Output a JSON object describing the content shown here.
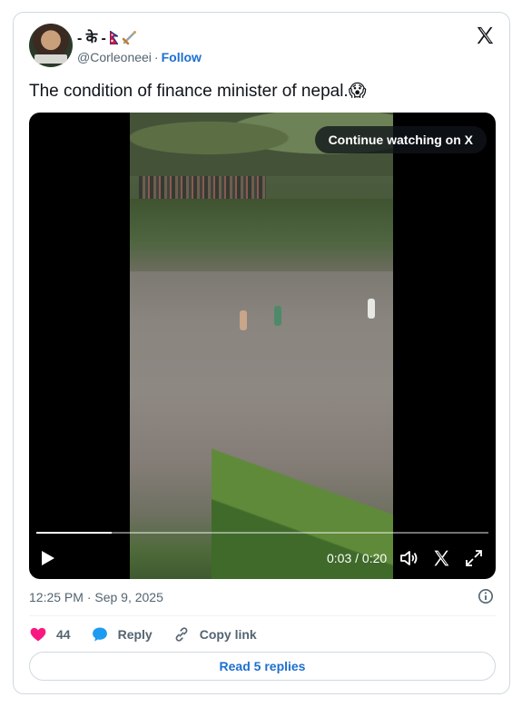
{
  "author": {
    "display_name_prefix": "- के -",
    "handle": "@Corleoneei",
    "separator": "·",
    "follow_label": "Follow"
  },
  "tweet": {
    "text": "The condition of finance minister of nepal.😱"
  },
  "video": {
    "overlay_label": "Continue watching on X",
    "time_display": "0:03 / 0:20",
    "progress_fraction": 0.167
  },
  "timestamp": "12:25 PM · Sep 9, 2025",
  "actions": {
    "likes_count": "44",
    "reply_label": "Reply",
    "copy_link_label": "Copy link"
  },
  "read_replies_label": "Read 5 replies",
  "colors": {
    "link": "#1d6fd0",
    "like": "#f91880",
    "reply_bubble": "#1d9bf0",
    "muted": "#536471"
  }
}
